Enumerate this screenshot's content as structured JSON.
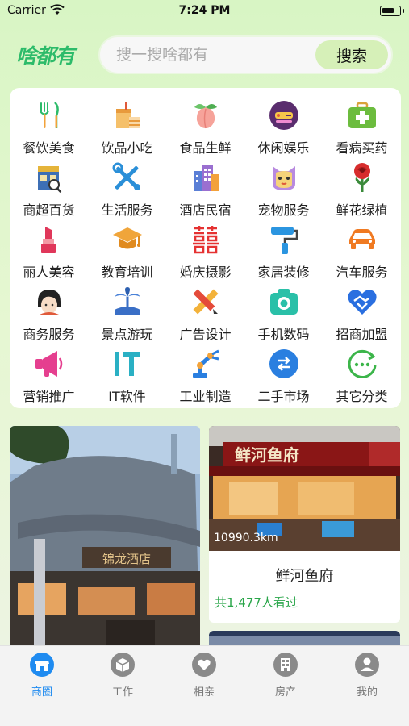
{
  "status_bar": {
    "carrier": "Carrier",
    "time": "7:24 PM"
  },
  "header": {
    "logo": "啥都有",
    "search_placeholder": "搜一搜啥都有",
    "search_button": "搜索"
  },
  "categories": [
    {
      "label": "餐饮美食",
      "icon": "utensils-icon"
    },
    {
      "label": "饮品小吃",
      "icon": "drink-icon"
    },
    {
      "label": "食品生鲜",
      "icon": "peach-icon"
    },
    {
      "label": "休闲娱乐",
      "icon": "leisure-icon"
    },
    {
      "label": "看病买药",
      "icon": "medical-kit-icon"
    },
    {
      "label": "商超百货",
      "icon": "store-icon"
    },
    {
      "label": "生活服务",
      "icon": "tools-icon"
    },
    {
      "label": "酒店民宿",
      "icon": "hotel-icon"
    },
    {
      "label": "宠物服务",
      "icon": "pet-icon"
    },
    {
      "label": "鲜花绿植",
      "icon": "rose-icon"
    },
    {
      "label": "丽人美容",
      "icon": "lipstick-icon"
    },
    {
      "label": "教育培训",
      "icon": "graduation-cap-icon"
    },
    {
      "label": "婚庆摄影",
      "icon": "double-happiness-icon"
    },
    {
      "label": "家居装修",
      "icon": "paint-roller-icon"
    },
    {
      "label": "汽车服务",
      "icon": "car-icon"
    },
    {
      "label": "商务服务",
      "icon": "headset-person-icon"
    },
    {
      "label": "景点游玩",
      "icon": "palm-island-icon"
    },
    {
      "label": "广告设计",
      "icon": "pencil-ruler-icon"
    },
    {
      "label": "手机数码",
      "icon": "camera-icon"
    },
    {
      "label": "招商加盟",
      "icon": "handshake-icon"
    },
    {
      "label": "营销推广",
      "icon": "megaphone-icon"
    },
    {
      "label": "IT软件",
      "icon": "it-icon"
    },
    {
      "label": "工业制造",
      "icon": "robot-arm-icon"
    },
    {
      "label": "二手市场",
      "icon": "exchange-icon"
    },
    {
      "label": "其它分类",
      "icon": "more-icon"
    }
  ],
  "feed": {
    "left_card": {
      "photo_text": "锦龙酒店"
    },
    "right_card": {
      "distance": "10990.3km",
      "title": "鲜河鱼府",
      "views": "共1,477人看过",
      "sign_text": "鲜河鱼府"
    }
  },
  "tabs": [
    {
      "label": "商圈",
      "icon": "store-front-icon",
      "active": true
    },
    {
      "label": "工作",
      "icon": "package-icon",
      "active": false
    },
    {
      "label": "相亲",
      "icon": "heart-icon",
      "active": false
    },
    {
      "label": "房产",
      "icon": "building-icon",
      "active": false
    },
    {
      "label": "我的",
      "icon": "user-icon",
      "active": false
    }
  ],
  "colors": {
    "accent_green": "#2dbb6a",
    "active_tab": "#1f8bf0",
    "views_green": "#2aa64a"
  }
}
